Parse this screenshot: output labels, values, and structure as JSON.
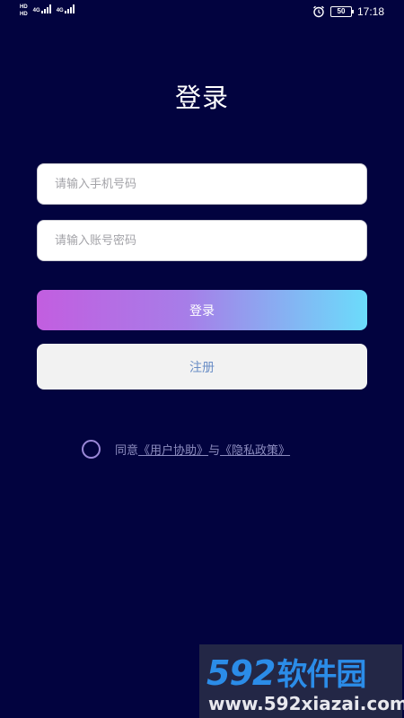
{
  "status_bar": {
    "sim1_label": "HD",
    "sim2_label": "HD",
    "net1": "4G",
    "net2": "4G",
    "battery": "50",
    "time": "17:18"
  },
  "page": {
    "title": "登录"
  },
  "form": {
    "phone_placeholder": "请输入手机号码",
    "password_placeholder": "请输入账号密码",
    "login_label": "登录",
    "register_label": "注册"
  },
  "agreement": {
    "prefix": "同意",
    "user_agreement": "《用户协助》",
    "connector": "与",
    "privacy_policy": "《隐私政策》"
  },
  "watermark": {
    "brand": "592",
    "brand_cn": "软件园",
    "url": "www.592xiazai.com"
  },
  "colors": {
    "background": "#02033f",
    "login_gradient_start": "#c25ee0",
    "login_gradient_end": "#6bdcfb",
    "register_bg": "#f2f2f2",
    "register_text": "#6b8ec6"
  }
}
